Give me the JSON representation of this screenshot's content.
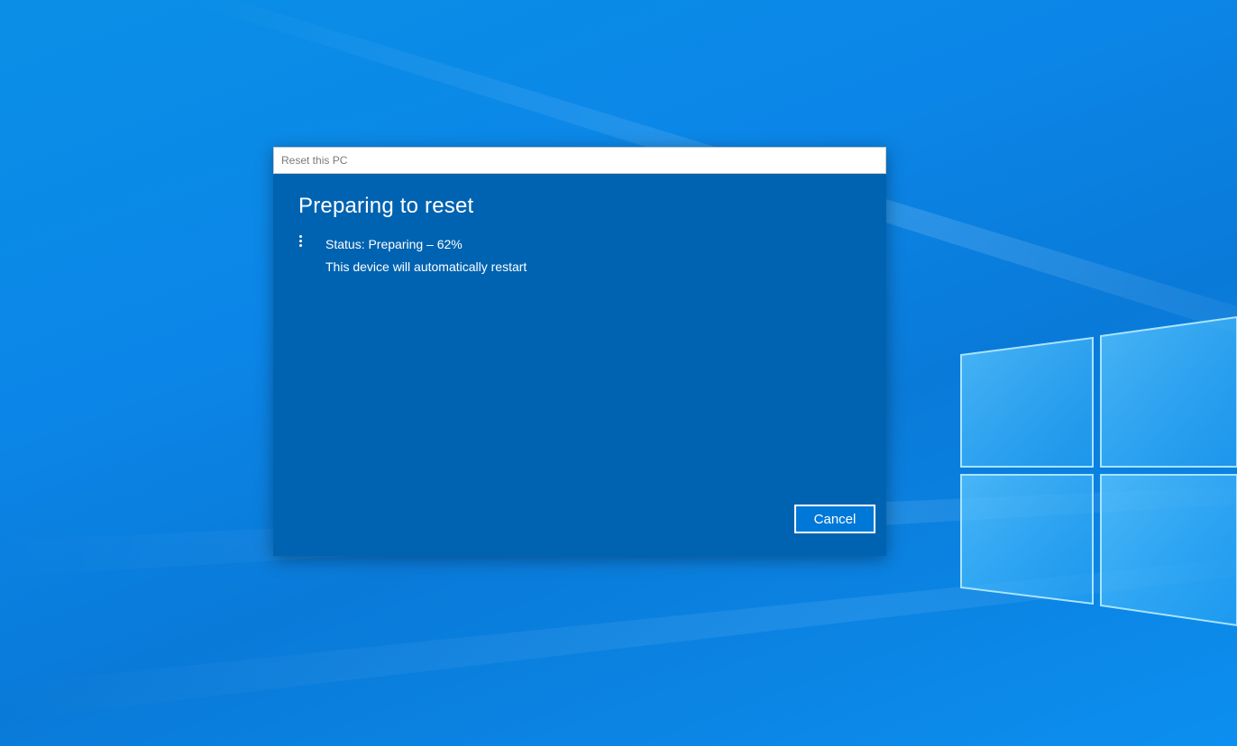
{
  "dialog": {
    "title": "Reset this PC",
    "heading": "Preparing to reset",
    "status_line": "Status: Preparing – 62%",
    "info_line": "This device will automatically restart",
    "progress_percent": 62,
    "cancel_label": "Cancel"
  },
  "icons": {
    "spinner": "loading-spinner-icon",
    "wallpaper_logo": "windows-logo-icon"
  },
  "colors": {
    "dialog_background": "#0063b1",
    "button_background": "#0078d7",
    "desktop_background": "#0b86e8",
    "text": "#ffffff"
  }
}
